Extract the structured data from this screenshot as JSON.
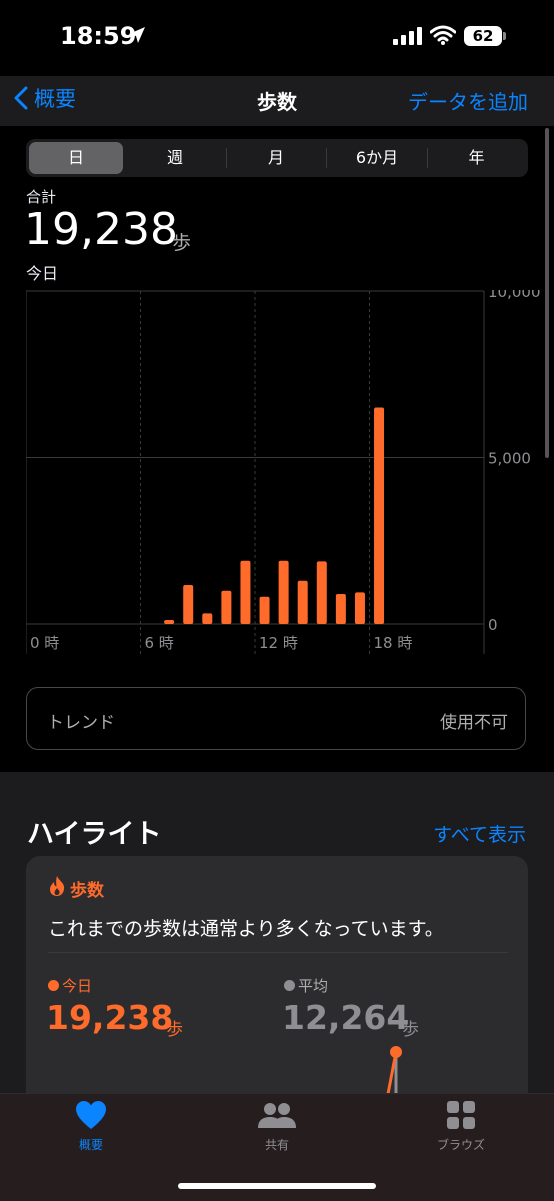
{
  "status": {
    "time": "18:59",
    "battery": "62"
  },
  "nav": {
    "back_label": "概要",
    "title": "歩数",
    "add_label": "データを追加"
  },
  "segments": [
    "日",
    "週",
    "月",
    "6か月",
    "年"
  ],
  "selected_segment": "日",
  "summary": {
    "total_label": "合計",
    "total_value": "19,238",
    "unit": "歩",
    "date_label": "今日"
  },
  "chart_data": {
    "type": "bar",
    "x_tick_labels": [
      "0 時",
      "6 時",
      "12 時",
      "18 時"
    ],
    "y_tick_labels": [
      "10,000",
      "5,000",
      "0"
    ],
    "ylim": [
      0,
      10000
    ],
    "xlim": [
      0,
      24
    ],
    "categories": [
      7,
      8,
      9,
      10,
      11,
      12,
      13,
      14,
      15,
      16,
      17,
      18
    ],
    "values": [
      120,
      1170,
      320,
      1000,
      1900,
      820,
      1900,
      1300,
      1880,
      900,
      950,
      6500
    ],
    "color": "#ff6b2b",
    "grid": true
  },
  "trend": {
    "label": "トレンド",
    "value": "使用不可"
  },
  "highlights": {
    "title": "ハイライト",
    "show_all": "すべて表示",
    "card": {
      "category": "歩数",
      "text": "これまでの歩数は通常より多くなっています。",
      "today_label": "今日",
      "today_value": "19,238",
      "avg_label": "平均",
      "avg_value": "12,264",
      "unit": "歩"
    }
  },
  "tabs": [
    {
      "label": "概要",
      "icon": "heart-icon",
      "active": true
    },
    {
      "label": "共有",
      "icon": "people-icon",
      "active": false
    },
    {
      "label": "ブラウズ",
      "icon": "grid-icon",
      "active": false
    }
  ],
  "colors": {
    "accent": "#0a84ff",
    "steps": "#ff6b2b"
  }
}
